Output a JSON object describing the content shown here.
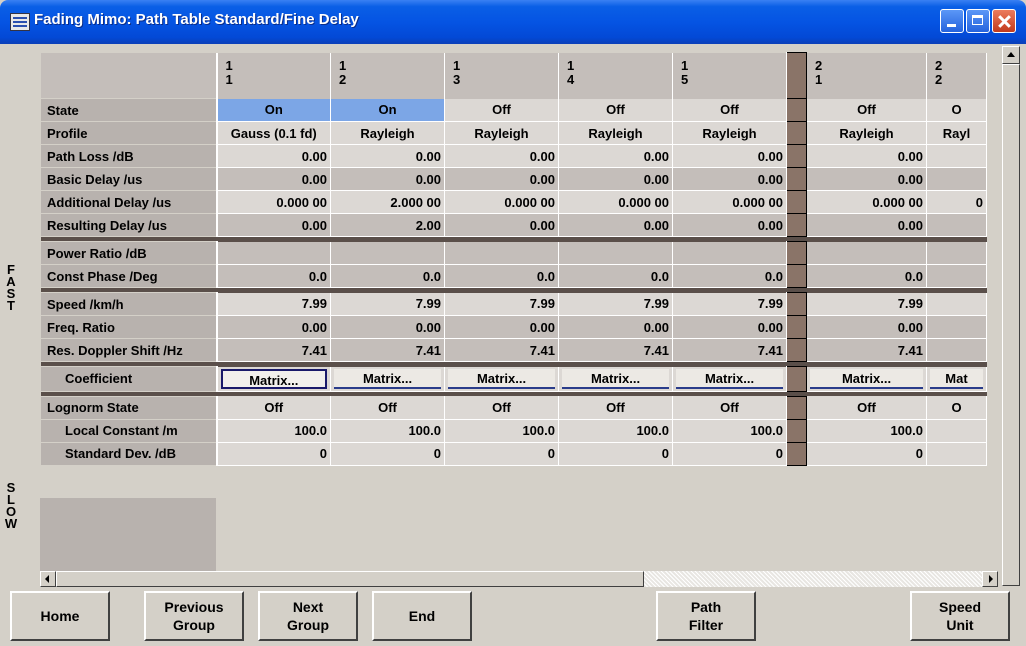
{
  "window": {
    "title": "Fading Mimo: Path Table Standard/Fine Delay"
  },
  "side_labels": {
    "fast": [
      "F",
      "A",
      "S",
      "T"
    ],
    "slow": [
      "S",
      "L",
      "O",
      "W"
    ]
  },
  "columns": [
    {
      "group": "1",
      "path": "1"
    },
    {
      "group": "1",
      "path": "2"
    },
    {
      "group": "1",
      "path": "3"
    },
    {
      "group": "1",
      "path": "4"
    },
    {
      "group": "1",
      "path": "5"
    },
    {
      "group": "2",
      "path": "1"
    },
    {
      "group": "2",
      "path": "2"
    }
  ],
  "rows": [
    {
      "label": "State",
      "values": [
        "On",
        "On",
        "Off",
        "Off",
        "Off",
        "Off",
        "O"
      ]
    },
    {
      "label": "Profile",
      "values": [
        "Gauss (0.1 fd)",
        "Rayleigh",
        "Rayleigh",
        "Rayleigh",
        "Rayleigh",
        "Rayleigh",
        "Rayl"
      ]
    },
    {
      "label": "Path Loss /dB",
      "values": [
        "0.00",
        "0.00",
        "0.00",
        "0.00",
        "0.00",
        "0.00",
        ""
      ]
    },
    {
      "label": "Basic Delay /us",
      "values": [
        "0.00",
        "0.00",
        "0.00",
        "0.00",
        "0.00",
        "0.00",
        ""
      ]
    },
    {
      "label": "Additional Delay /us",
      "values": [
        "0.000 00",
        "2.000 00",
        "0.000 00",
        "0.000 00",
        "0.000 00",
        "0.000 00",
        "0"
      ]
    },
    {
      "label": "Resulting Delay /us",
      "values": [
        "0.00",
        "2.00",
        "0.00",
        "0.00",
        "0.00",
        "0.00",
        ""
      ]
    },
    {
      "label": "Power Ratio /dB",
      "values": [
        "",
        "",
        "",
        "",
        "",
        "",
        ""
      ]
    },
    {
      "label": "Const Phase /Deg",
      "values": [
        "0.0",
        "0.0",
        "0.0",
        "0.0",
        "0.0",
        "0.0",
        ""
      ]
    },
    {
      "label": "Speed /km/h",
      "values": [
        "7.99",
        "7.99",
        "7.99",
        "7.99",
        "7.99",
        "7.99",
        ""
      ]
    },
    {
      "label": "Freq. Ratio",
      "values": [
        "0.00",
        "0.00",
        "0.00",
        "0.00",
        "0.00",
        "0.00",
        ""
      ]
    },
    {
      "label": "Res. Doppler Shift /Hz",
      "values": [
        "7.41",
        "7.41",
        "7.41",
        "7.41",
        "7.41",
        "7.41",
        ""
      ]
    },
    {
      "label": "Coefficient",
      "values": [
        "Matrix...",
        "Matrix...",
        "Matrix...",
        "Matrix...",
        "Matrix...",
        "Matrix...",
        "Mat"
      ]
    },
    {
      "label": "Lognorm State",
      "values": [
        "Off",
        "Off",
        "Off",
        "Off",
        "Off",
        "Off",
        "O"
      ]
    },
    {
      "label": "Local Constant /m",
      "values": [
        "100.0",
        "100.0",
        "100.0",
        "100.0",
        "100.0",
        "100.0",
        ""
      ]
    },
    {
      "label": "Standard Dev. /dB",
      "values": [
        "0",
        "0",
        "0",
        "0",
        "0",
        "0",
        ""
      ]
    }
  ],
  "buttons": {
    "home": "Home",
    "previous_group": [
      "Previous",
      "Group"
    ],
    "next_group": [
      "Next",
      "Group"
    ],
    "end": "End",
    "path_filter": [
      "Path",
      "Filter"
    ],
    "speed_unit": [
      "Speed",
      "Unit"
    ]
  },
  "colors": {
    "selected_cell": "#7ca6e6",
    "title_bar": "#0554e3",
    "separator": "#8a7468"
  }
}
